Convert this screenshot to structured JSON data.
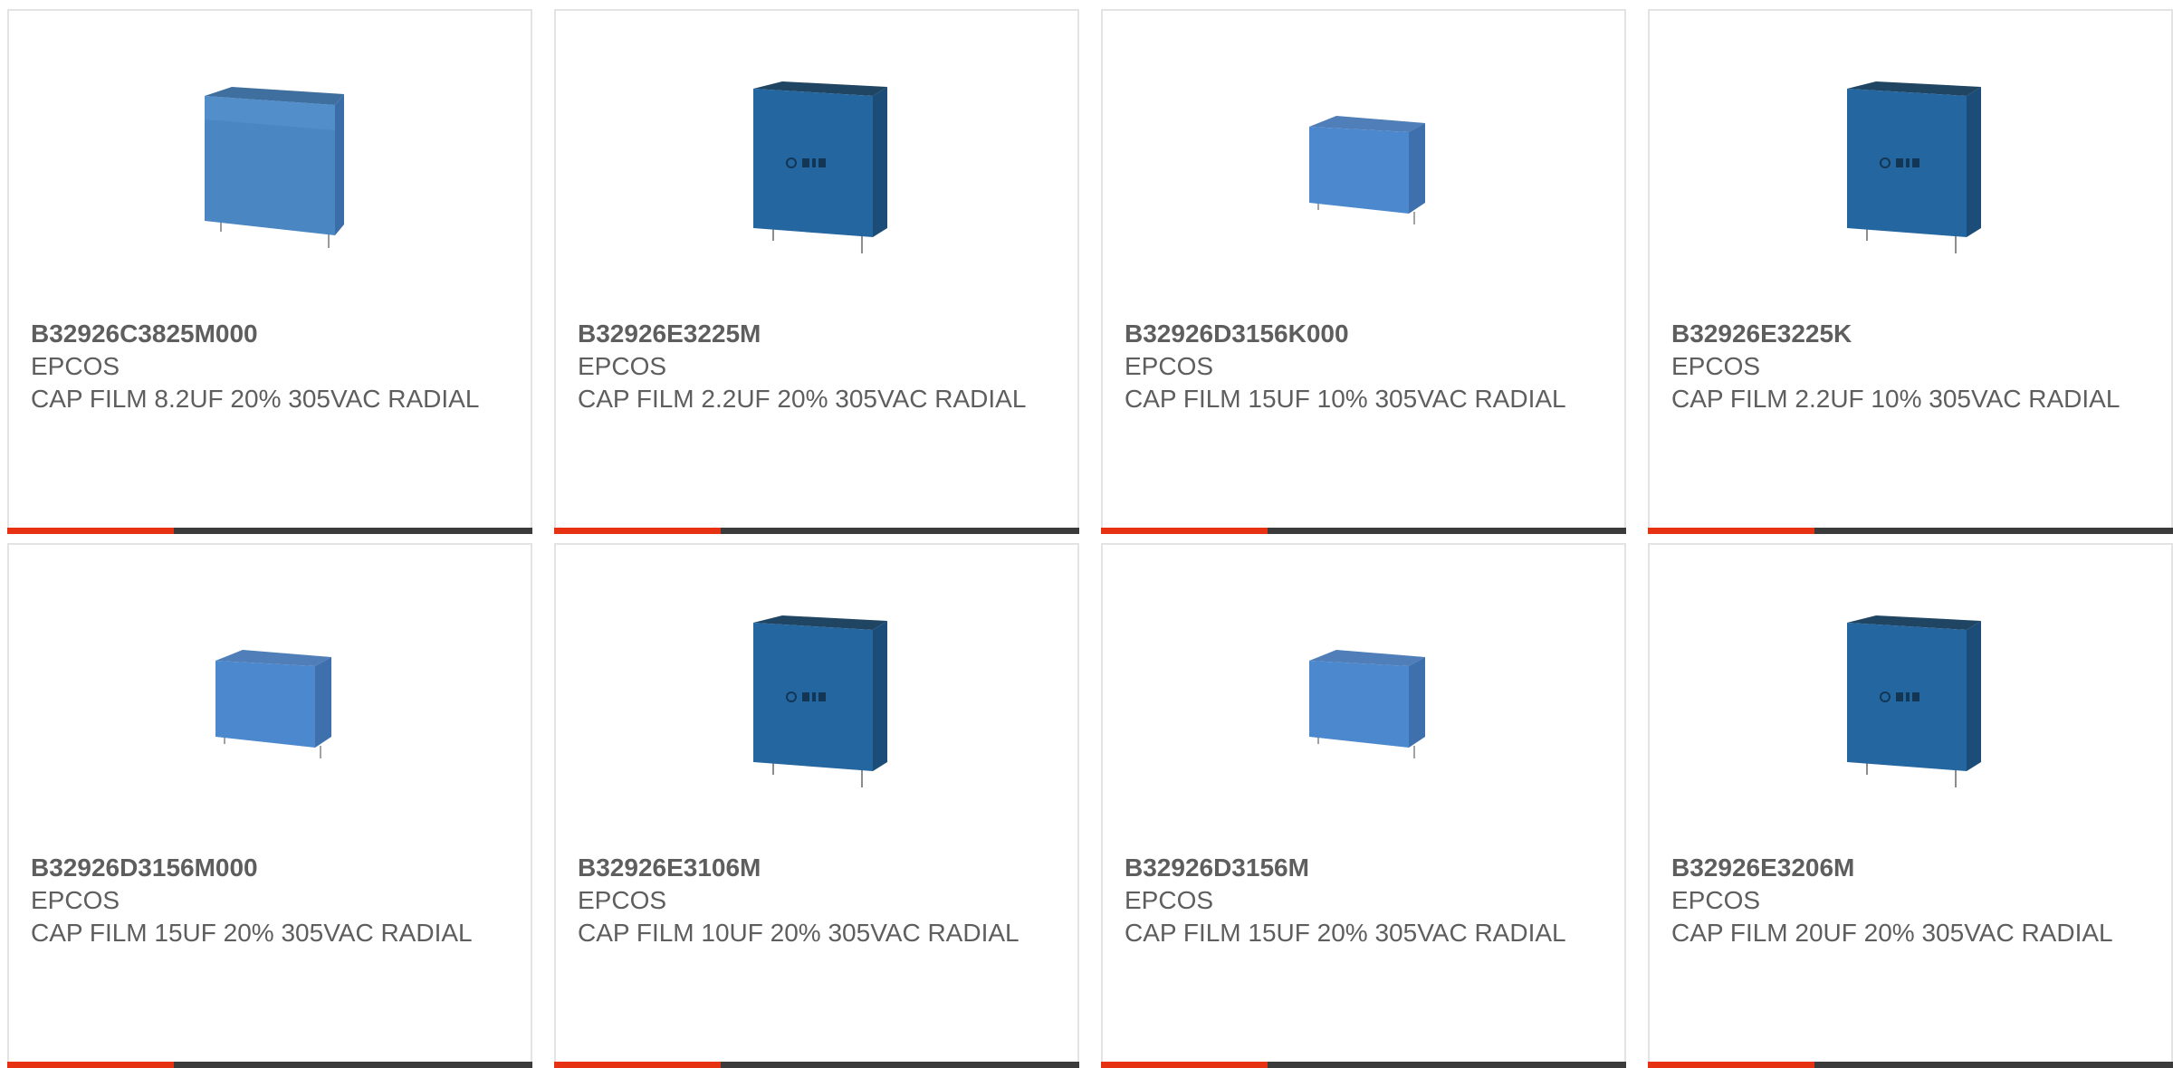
{
  "colors": {
    "card_border": "#e3e3e3",
    "text": "#5e5e5e",
    "bar_dark": "#3b3b3b",
    "bar_accent": "#e63212"
  },
  "products": [
    {
      "part_number": "B32926C3825M000",
      "manufacturer": "EPCOS",
      "description": "CAP FILM 8.2UF 20% 305VAC RADIAL",
      "image": "capacitor-large-light-blue-icon"
    },
    {
      "part_number": "B32926E3225M",
      "manufacturer": "EPCOS",
      "description": "CAP FILM 2.2UF 20% 305VAC RADIAL",
      "image": "capacitor-tall-dark-blue-icon"
    },
    {
      "part_number": "B32926D3156K000",
      "manufacturer": "EPCOS",
      "description": "CAP FILM 15UF 10% 305VAC RADIAL",
      "image": "capacitor-small-light-blue-icon"
    },
    {
      "part_number": "B32926E3225K",
      "manufacturer": "EPCOS",
      "description": "CAP FILM 2.2UF 10% 305VAC RADIAL",
      "image": "capacitor-tall-dark-blue-icon"
    },
    {
      "part_number": "B32926D3156M000",
      "manufacturer": "EPCOS",
      "description": "CAP FILM 15UF 20% 305VAC RADIAL",
      "image": "capacitor-small-light-blue-icon"
    },
    {
      "part_number": "B32926E3106M",
      "manufacturer": "EPCOS",
      "description": "CAP FILM 10UF 20% 305VAC RADIAL",
      "image": "capacitor-tall-dark-blue-icon"
    },
    {
      "part_number": "B32926D3156M",
      "manufacturer": "EPCOS",
      "description": "CAP FILM 15UF 20% 305VAC RADIAL",
      "image": "capacitor-small-light-blue-icon"
    },
    {
      "part_number": "B32926E3206M",
      "manufacturer": "EPCOS",
      "description": "CAP FILM 20UF 20% 305VAC RADIAL",
      "image": "capacitor-tall-dark-blue-icon"
    }
  ]
}
